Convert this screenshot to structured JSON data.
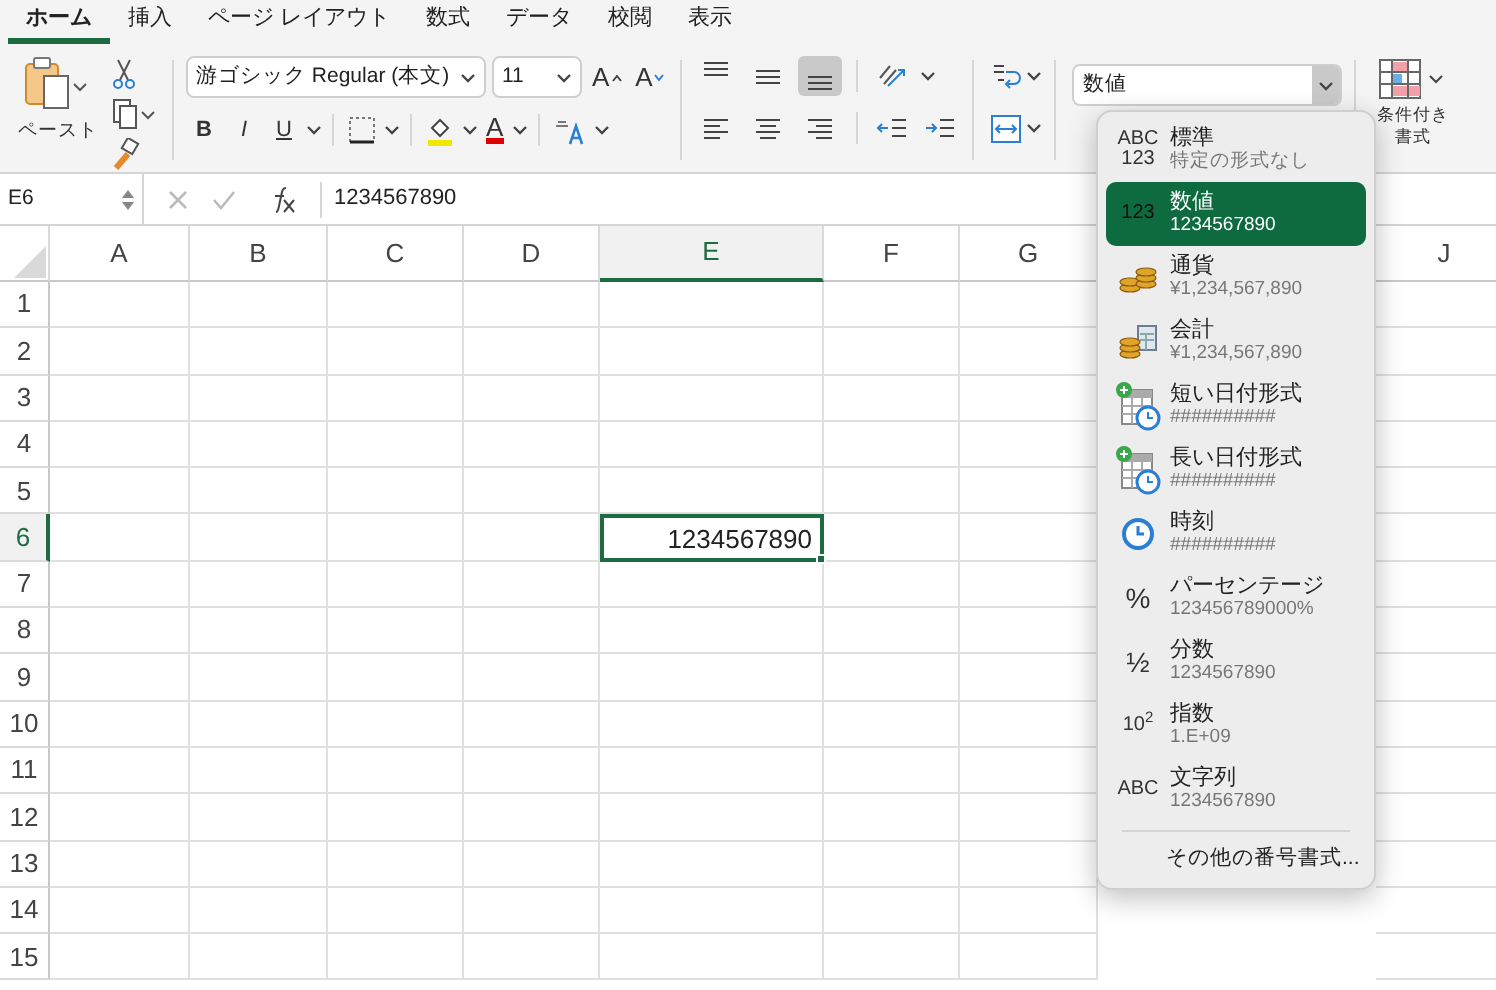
{
  "tabs": [
    {
      "label": "ホーム",
      "selected": true
    },
    {
      "label": "挿入",
      "selected": false
    },
    {
      "label": "ページ レイアウト",
      "selected": false
    },
    {
      "label": "数式",
      "selected": false
    },
    {
      "label": "データ",
      "selected": false
    },
    {
      "label": "校閲",
      "selected": false
    },
    {
      "label": "表示",
      "selected": false
    }
  ],
  "ribbon": {
    "paste_label": "ペースト",
    "font_name": "游ゴシック Regular (本文)",
    "font_size": "11",
    "grow_letter": "A",
    "shrink_letter": "A",
    "bold": "B",
    "italic": "I",
    "underline": "U",
    "font_color_letter": "A",
    "vertical_align": [
      {
        "kind": "top",
        "selected": false
      },
      {
        "kind": "middle",
        "selected": false
      },
      {
        "kind": "bottom",
        "selected": true
      }
    ],
    "number_format": "数値",
    "conditional_format": [
      "条件付き",
      "書式"
    ]
  },
  "formula_bar": {
    "cell_ref": "E6",
    "formula": "1234567890"
  },
  "sheet": {
    "columns": [
      {
        "label": "A",
        "selected": false
      },
      {
        "label": "B",
        "selected": false
      },
      {
        "label": "C",
        "selected": false
      },
      {
        "label": "D",
        "selected": false
      },
      {
        "label": "E",
        "selected": true
      },
      {
        "label": "F",
        "selected": false
      },
      {
        "label": "G",
        "selected": false
      },
      {
        "kind": "covered"
      },
      {
        "kind": "covered"
      },
      {
        "label": "J",
        "selected": false
      }
    ],
    "rows": [
      {
        "label": "1",
        "selected": false
      },
      {
        "label": "2",
        "selected": false
      },
      {
        "label": "3",
        "selected": false
      },
      {
        "label": "4",
        "selected": false
      },
      {
        "label": "5",
        "selected": false
      },
      {
        "label": "6",
        "selected": true
      },
      {
        "label": "7",
        "selected": false
      },
      {
        "label": "8",
        "selected": false
      },
      {
        "label": "9",
        "selected": false
      },
      {
        "label": "10",
        "selected": false
      },
      {
        "label": "11",
        "selected": false
      },
      {
        "label": "12",
        "selected": false
      },
      {
        "label": "13",
        "selected": false
      },
      {
        "label": "14",
        "selected": false
      },
      {
        "label": "15",
        "selected": false
      }
    ],
    "active_value": "1234567890"
  },
  "format_menu": {
    "items": [
      {
        "kind": "general",
        "icon_text": [
          "ABC",
          "123"
        ],
        "title": "標準",
        "sample": "特定の形式なし",
        "selected": false
      },
      {
        "kind": "number",
        "icon_text": [
          "123"
        ],
        "title": "数値",
        "sample": "1234567890",
        "selected": true
      },
      {
        "kind": "currency",
        "title": "通貨",
        "sample": "¥1,234,567,890",
        "selected": false
      },
      {
        "kind": "accounting",
        "title": "会計",
        "sample": " ¥1,234,567,890",
        "selected": false
      },
      {
        "kind": "short_date",
        "title": "短い日付形式",
        "sample": "##########",
        "selected": false
      },
      {
        "kind": "long_date",
        "title": "長い日付形式",
        "sample": "##########",
        "selected": false
      },
      {
        "kind": "time",
        "title": "時刻",
        "sample": "##########",
        "selected": false
      },
      {
        "kind": "percent",
        "icon_text": [
          "%"
        ],
        "title": "パーセンテージ",
        "sample": "123456789000%",
        "selected": false
      },
      {
        "kind": "fraction",
        "icon_text": [
          "½"
        ],
        "title": "分数",
        "sample": "1234567890",
        "selected": false
      },
      {
        "kind": "scientific",
        "icon_text": [
          "10$^{2}$"
        ],
        "title": "指数",
        "sample": "1.E+09",
        "selected": false
      },
      {
        "kind": "text",
        "icon_text": [
          "ABC"
        ],
        "title": "文字列",
        "sample": "1234567890",
        "selected": false
      }
    ],
    "footer": "その他の番号書式..."
  }
}
